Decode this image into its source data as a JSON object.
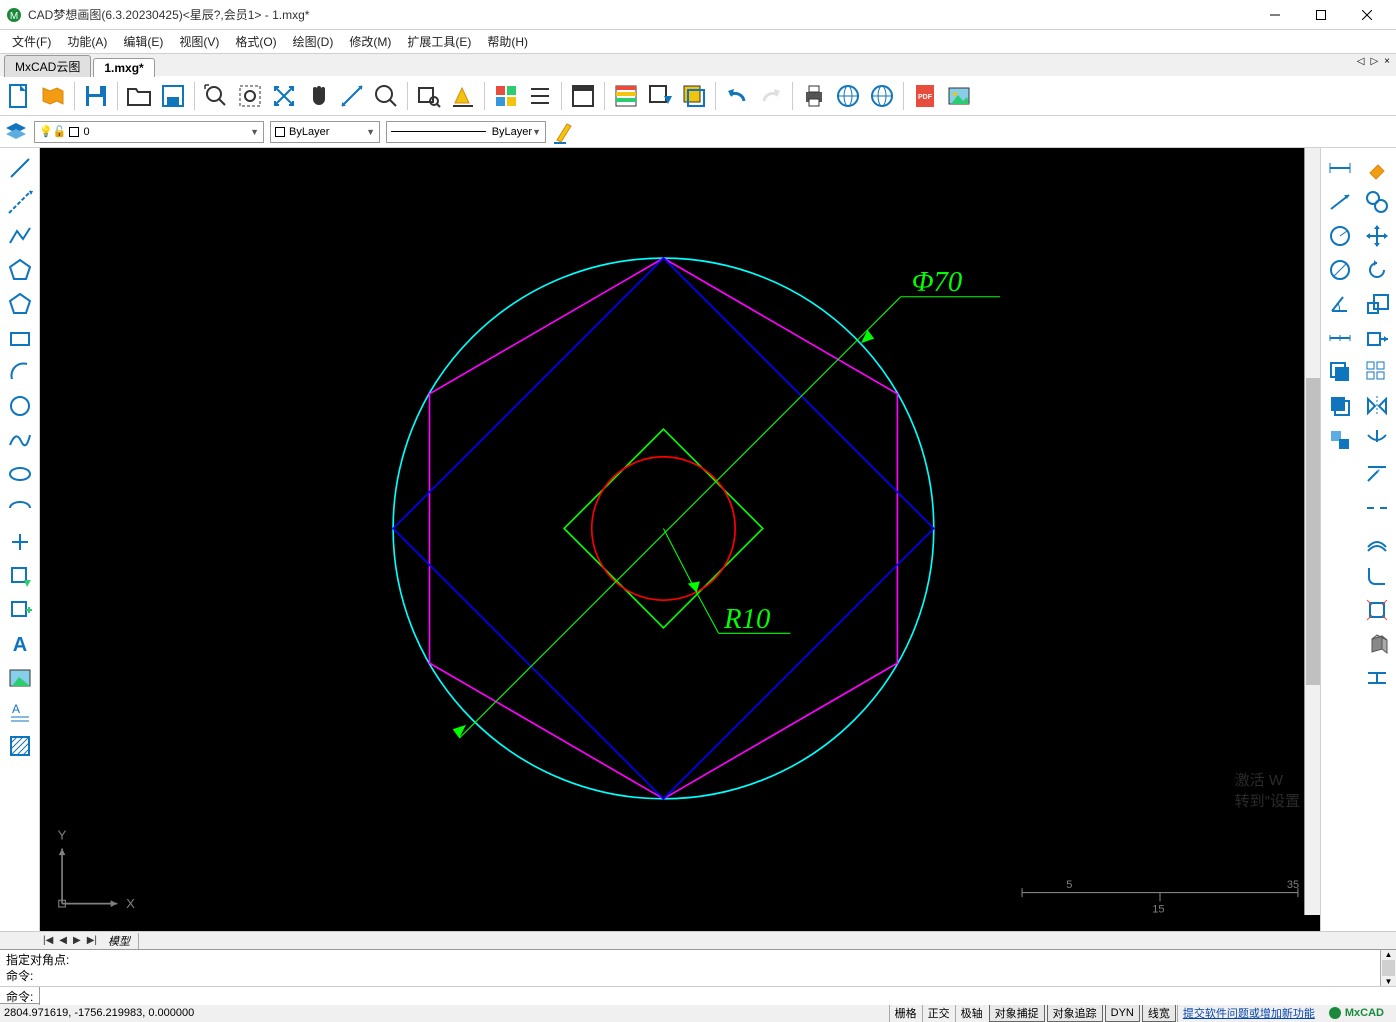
{
  "window": {
    "title": "CAD梦想画图(6.3.20230425)<星辰?,会员1> - 1.mxg*"
  },
  "menu": {
    "file": "文件(F)",
    "function": "功能(A)",
    "edit": "编辑(E)",
    "view": "视图(V)",
    "format": "格式(O)",
    "draw": "绘图(D)",
    "modify": "修改(M)",
    "extend": "扩展工具(E)",
    "help": "帮助(H)"
  },
  "doc_tabs": {
    "tab1": "MxCAD云图",
    "tab2": "1.mxg*"
  },
  "layer": {
    "current": "0",
    "color": "ByLayer",
    "linetype": "ByLayer"
  },
  "model_tabs": {
    "model": "模型"
  },
  "drawing": {
    "dim_diameter": "Φ70",
    "dim_radius": "R10",
    "ruler_left": "5",
    "ruler_right": "35",
    "ruler_mid": "15",
    "axis_x": "X",
    "axis_y": "Y"
  },
  "command": {
    "hist1": "指定对角点:",
    "hist2": "命令:",
    "prompt": "命令:"
  },
  "statusbar": {
    "coords": "2804.971619,  -1756.219983,  0.000000",
    "grid": "栅格",
    "ortho": "正交",
    "polar": "极轴",
    "osnap": "对象捕捉",
    "otrack": "对象追踪",
    "dyn": "DYN",
    "lwt": "线宽",
    "feedback": "提交软件问题或增加新功能",
    "brand": "MxCAD"
  },
  "watermark": {
    "line1": "激活 W",
    "line2": "转到\"设置"
  }
}
